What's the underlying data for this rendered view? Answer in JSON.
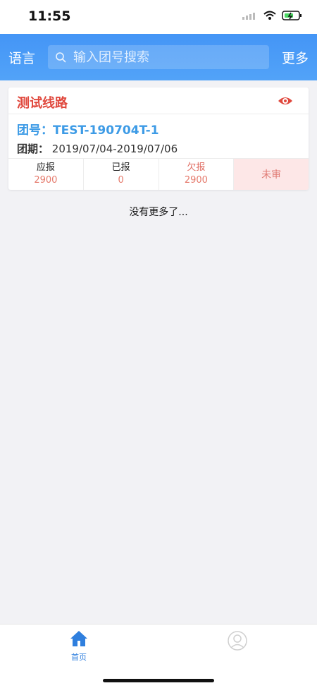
{
  "status": {
    "time": "11:55"
  },
  "header": {
    "language": "语言",
    "search_placeholder": "输入团号搜索",
    "more": "更多"
  },
  "card": {
    "title": "测试线路",
    "group_no": "团号：TEST-190704T-1",
    "date_label": "团期：",
    "date_value": "2019/07/04-2019/07/06",
    "stats": [
      {
        "label": "应报",
        "value": "2900"
      },
      {
        "label": "已报",
        "value": "0"
      },
      {
        "label": "欠报",
        "value": "2900"
      },
      {
        "label": "未审"
      }
    ]
  },
  "footer_text": "没有更多了...",
  "tabs": [
    {
      "label": "首页",
      "icon": "home-icon"
    },
    {
      "label": "",
      "icon": "user-icon"
    }
  ],
  "colors": {
    "header_blue": "#3a8bf5",
    "title_red": "#e0483d",
    "group_blue": "#3d9be6",
    "review_bg": "#fde7e7"
  }
}
